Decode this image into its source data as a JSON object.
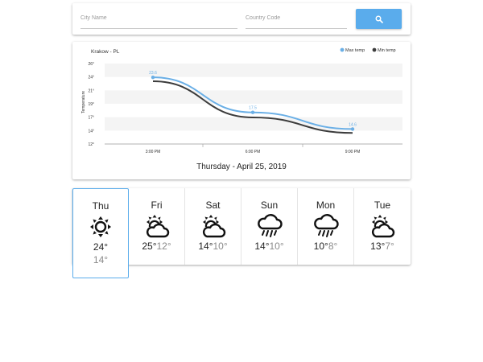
{
  "search": {
    "city_placeholder": "City Name",
    "country_placeholder": "Country Code",
    "city_value": "",
    "country_value": "",
    "button_icon": "search-icon",
    "accent_color": "#5aacec"
  },
  "chart_data": {
    "type": "line",
    "title": "Krakow - PL",
    "ylabel": "Temperature",
    "xlabel": "",
    "categories": [
      "3:00 PM",
      "6:00 PM",
      "9:00 PM"
    ],
    "series": [
      {
        "name": "Max temp",
        "values": [
          23.6,
          17.5,
          14.6
        ],
        "color": "#6aafe6"
      },
      {
        "name": "Min temp",
        "values": [
          23.2,
          16.9,
          14.2
        ],
        "color": "#3c3c3c"
      }
    ],
    "data_labels": [
      "23.6",
      "17.5",
      "14.6"
    ],
    "yticks": [
      "26°",
      "24°",
      "21°",
      "19°",
      "17°",
      "14°",
      "12°"
    ],
    "ylim": [
      12,
      26
    ],
    "legend_position": "top-right",
    "grid": true
  },
  "date_label": "Thursday - April 25, 2019",
  "forecast": [
    {
      "day": "Thu",
      "icon": "sun-icon",
      "max": "24°",
      "min": "14°",
      "selected": true
    },
    {
      "day": "Fri",
      "icon": "partly-cloudy-icon",
      "max": "25°",
      "min": "12°",
      "selected": false
    },
    {
      "day": "Sat",
      "icon": "partly-cloudy-icon",
      "max": "14°",
      "min": "10°",
      "selected": false
    },
    {
      "day": "Sun",
      "icon": "rain-cloud-icon",
      "max": "14°",
      "min": "10°",
      "selected": false
    },
    {
      "day": "Mon",
      "icon": "rain-cloud-icon",
      "max": "10°",
      "min": "8°",
      "selected": false
    },
    {
      "day": "Tue",
      "icon": "partly-cloudy-icon",
      "max": "13°",
      "min": "7°",
      "selected": false
    }
  ]
}
